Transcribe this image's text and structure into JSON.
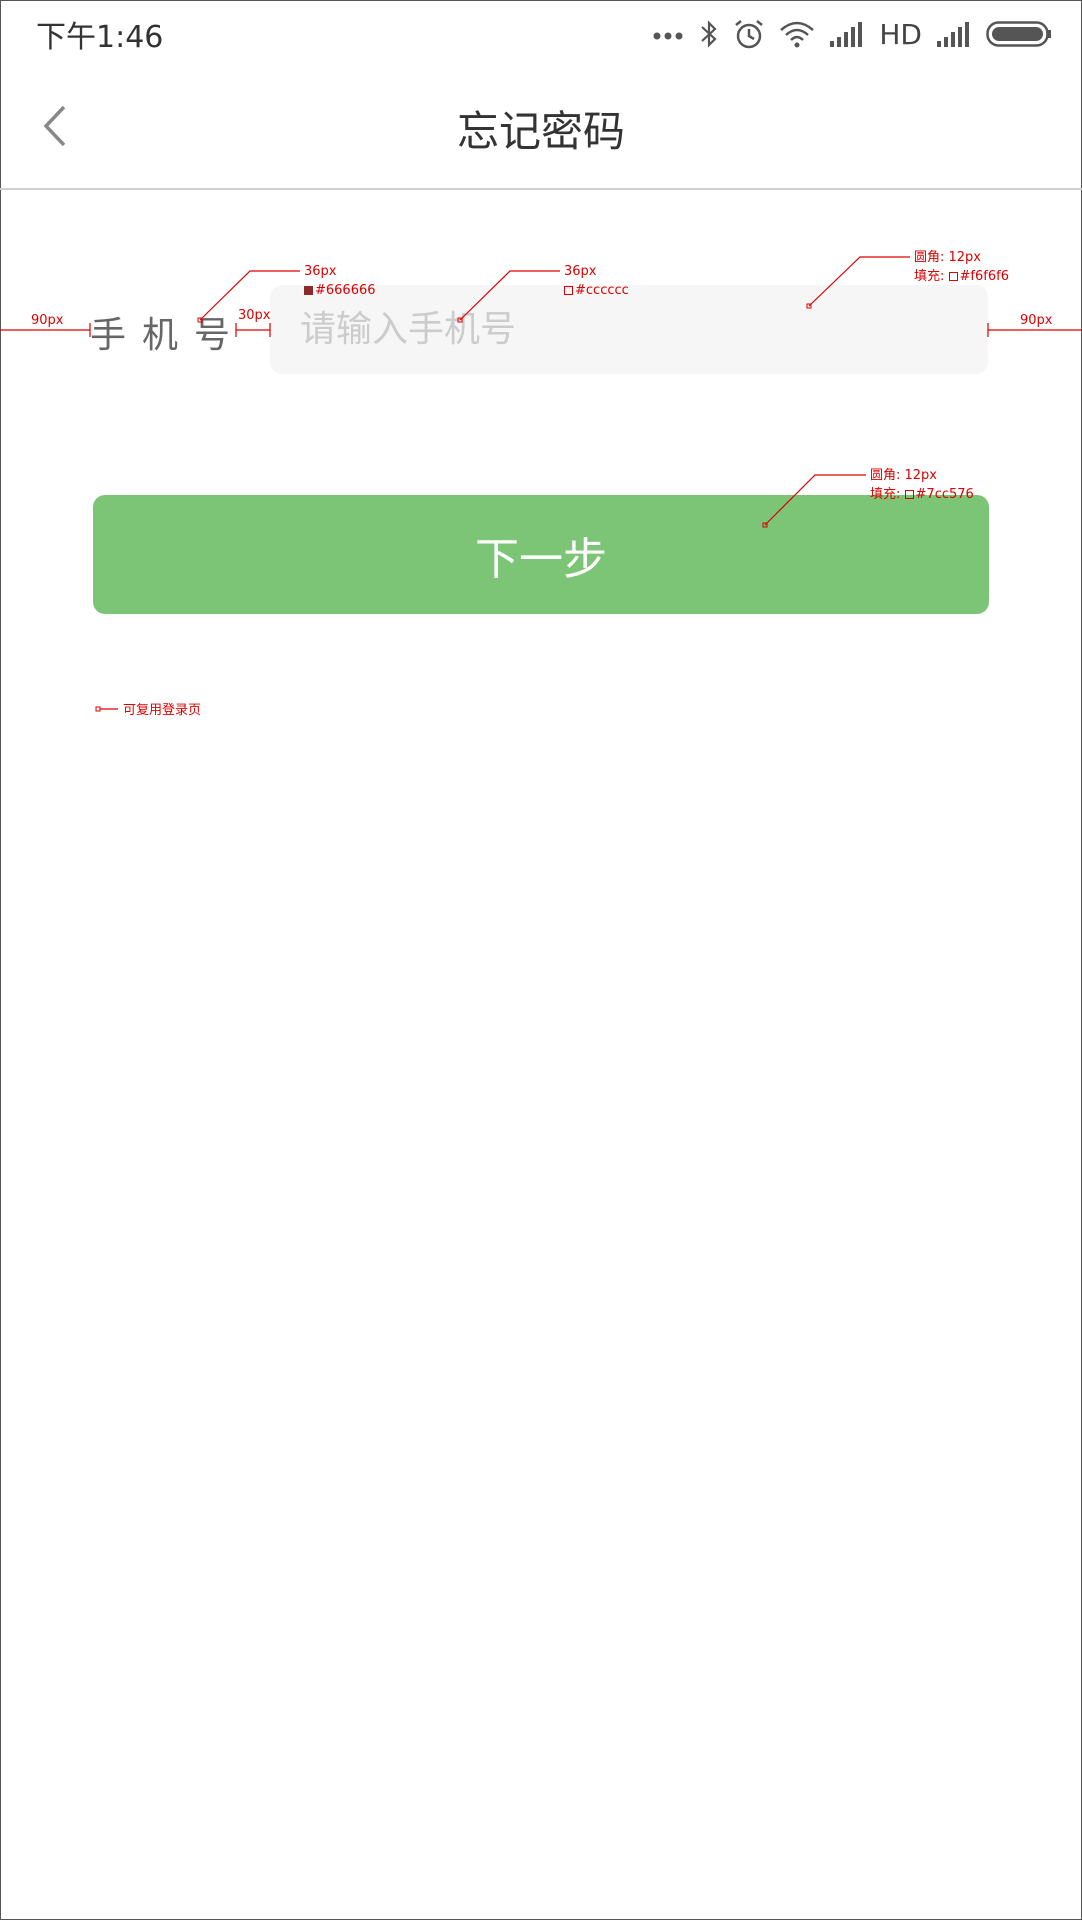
{
  "status_bar": {
    "time": "下午1:46",
    "icons": [
      "more-dots-icon",
      "bluetooth-icon",
      "alarm-icon",
      "wifi-icon",
      "signal-icon",
      "signal-icon"
    ],
    "hd_label": "HD"
  },
  "nav": {
    "title": "忘记密码",
    "back_icon": "chevron-left-icon"
  },
  "form": {
    "phone_label": "手机号",
    "phone_placeholder": "请输入手机号",
    "phone_value": ""
  },
  "next_button": {
    "label": "下一步"
  },
  "annotations": {
    "left_margin": "90px",
    "right_margin": "90px",
    "label_gap": "30px",
    "label_size": "36px",
    "label_color": "#666666",
    "placeholder_size": "36px",
    "placeholder_color": "#cccccc",
    "input_radius": "圆角: 12px",
    "input_fill": "填充:",
    "input_fill_color": "#f6f6f6",
    "button_radius": "圆角: 12px",
    "button_fill": "填充:",
    "button_fill_color": "#7cc576",
    "reuse_note": "可复用登录页"
  },
  "colors": {
    "accent_green": "#7cc576",
    "input_bg": "#f6f6f6",
    "annotation_red": "#dd0000"
  }
}
